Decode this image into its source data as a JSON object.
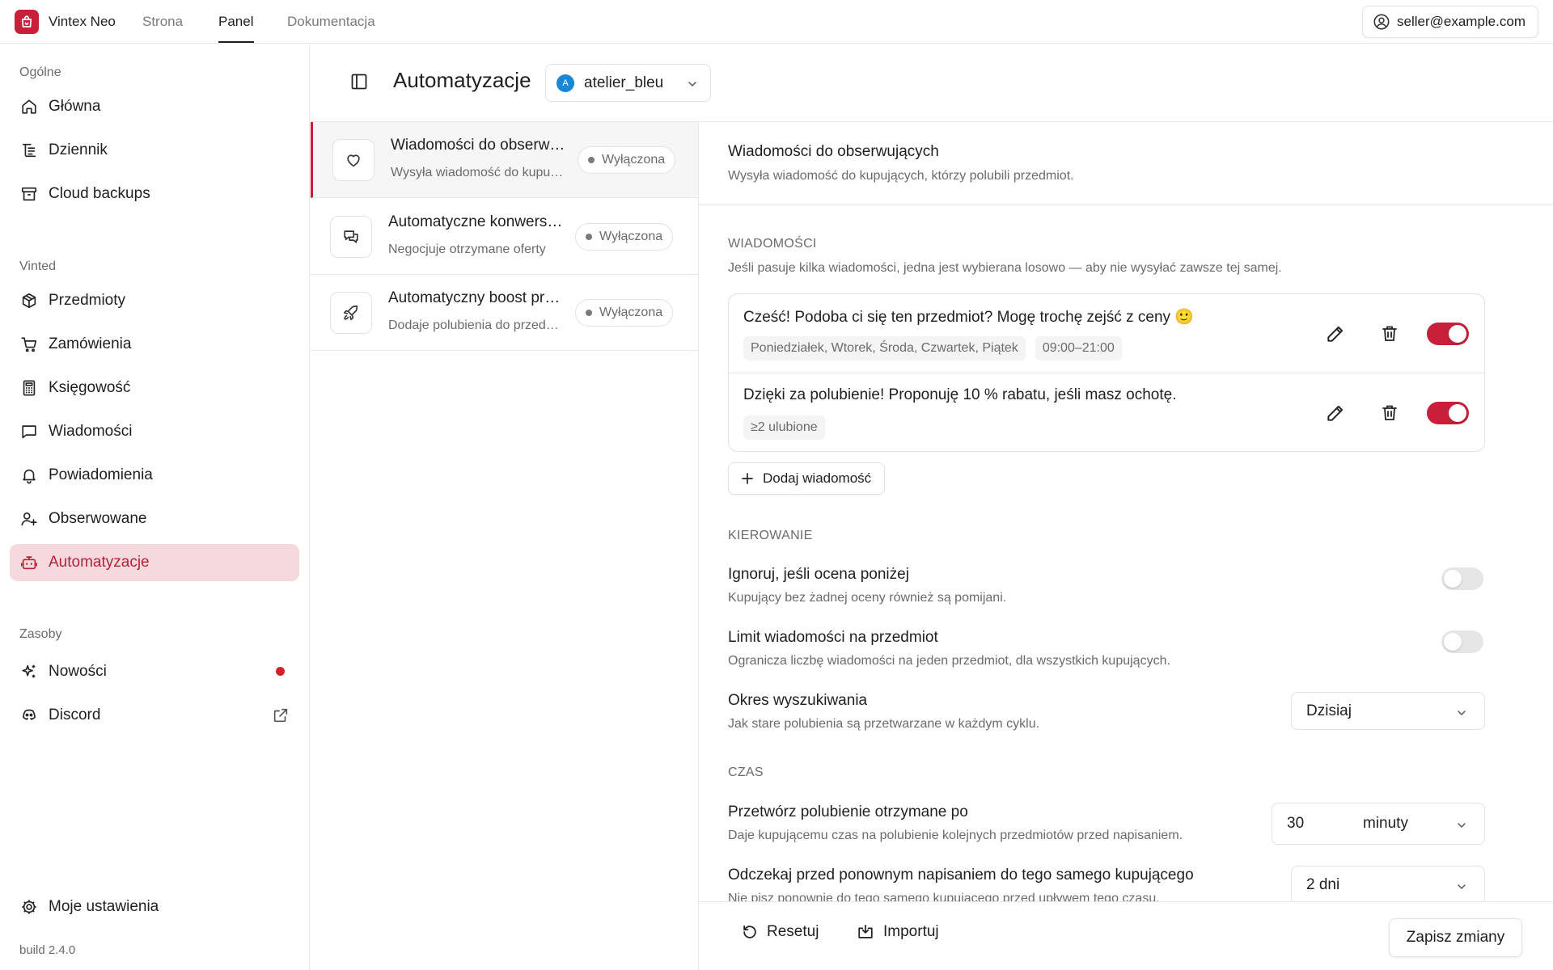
{
  "topbar": {
    "brand": "Vintex Neo",
    "nav": [
      "Strona",
      "Panel",
      "Dokumentacja"
    ],
    "active_nav": "Panel",
    "account_email": "seller@example.com"
  },
  "sidebar": {
    "groups": {
      "general": "Ogólne",
      "vinted": "Vinted",
      "resources": "Zasoby"
    },
    "general_items": [
      {
        "label": "Główna",
        "icon": "home-icon"
      },
      {
        "label": "Dziennik",
        "icon": "log-icon"
      },
      {
        "label": "Cloud backups",
        "icon": "archive-icon"
      }
    ],
    "vinted_items": [
      {
        "label": "Przedmioty",
        "icon": "package-icon"
      },
      {
        "label": "Zamówienia",
        "icon": "cart-icon"
      },
      {
        "label": "Księgowość",
        "icon": "calculator-icon"
      },
      {
        "label": "Wiadomości",
        "icon": "message-icon"
      },
      {
        "label": "Powiadomienia",
        "icon": "bell-icon"
      },
      {
        "label": "Obserwowane",
        "icon": "user-plus-icon"
      },
      {
        "label": "Automatyzacje",
        "icon": "robot-icon"
      }
    ],
    "active_item": "Automatyzacje",
    "resource_items": [
      {
        "label": "Nowości",
        "icon": "sparkles-icon"
      },
      {
        "label": "Discord",
        "icon": "discord-icon"
      }
    ],
    "settings_label": "Moje ustawienia",
    "build": "build 2.4.0"
  },
  "header": {
    "title": "Automatyzacje",
    "account": "atelier_bleu",
    "avatar_letter": "A"
  },
  "automations": [
    {
      "title": "Wiadomości do obserwujących",
      "subtitle": "Wysyła wiadomość do kupujących, którzy polubili przedmiot.",
      "status": "Wyłączona",
      "icon": "heart-icon"
    },
    {
      "title": "Automatyczne konwersacje",
      "subtitle": "Negocjuje otrzymane oferty",
      "status": "Wyłączona",
      "icon": "chat-icon"
    },
    {
      "title": "Automatyczny boost przedmiotów",
      "subtitle": "Dodaje polubienia do przedmiotów",
      "status": "Wyłączona",
      "icon": "rocket-icon"
    }
  ],
  "detail": {
    "title": "Wiadomości do obserwujących",
    "subtitle": "Wysyła wiadomość do kupujących, którzy polubili przedmiot.",
    "messages_label": "WIADOMOŚCI",
    "messages_hint": "Jeśli pasuje kilka wiadomości, jedna jest wybierana losowo — aby nie wysyłać zawsze tej samej.",
    "messages": [
      {
        "text": "Cześć! Podoba ci się ten przedmiot? Mogę trochę zejść z ceny 🙂",
        "chips": [
          "Poniedziałek, Wtorek, Środa, Czwartek, Piątek",
          "09:00–21:00"
        ],
        "enabled": true
      },
      {
        "text": "Dzięki za polubienie! Proponuję 10 % rabatu, jeśli masz ochotę.",
        "chips": [
          "≥2 ulubione"
        ],
        "enabled": true
      }
    ],
    "add_message": "Dodaj wiadomość",
    "targeting_label": "KIEROWANIE",
    "ignore_rating": {
      "title": "Ignoruj, jeśli ocena poniżej",
      "subtitle": "Kupujący bez żadnej oceny również są pomijani.",
      "enabled": false
    },
    "limit_per_item": {
      "title": "Limit wiadomości na przedmiot",
      "subtitle": "Ogranicza liczbę wiadomości na jeden przedmiot, dla wszystkich kupujących.",
      "enabled": false
    },
    "search_period": {
      "title": "Okres wyszukiwania",
      "subtitle": "Jak stare polubienia są przetwarzane w każdym cyklu.",
      "value": "Dzisiaj"
    },
    "time_label": "CZAS",
    "process_after": {
      "title": "Przetwórz polubienie otrzymane po",
      "subtitle": "Daje kupującemu czas na polubienie kolejnych przedmiotów przed napisaniem.",
      "amount": "30",
      "unit": "minuty"
    },
    "wait_before": {
      "title": "Odczekaj przed ponownym napisaniem do tego samego kupującego",
      "subtitle": "Nie pisz ponownie do tego samego kupującego przed upływem tego czasu.",
      "value": "2 dni"
    }
  },
  "footer": {
    "reset": "Resetuj",
    "import": "Importuj",
    "save": "Zapisz zmiany"
  }
}
